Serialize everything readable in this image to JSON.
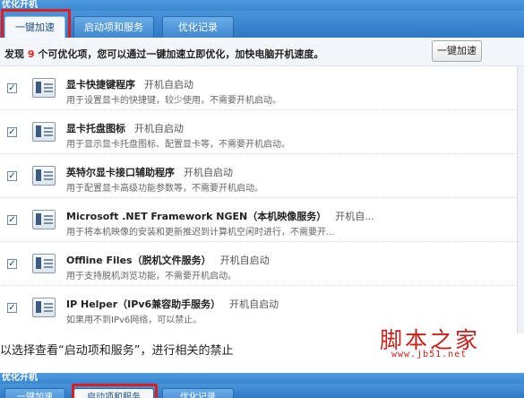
{
  "window": {
    "title": "优化开机",
    "tabs": [
      {
        "label": "一键加速",
        "active": true
      },
      {
        "label": "启动项和服务",
        "active": false
      },
      {
        "label": "优化记录",
        "active": false
      }
    ]
  },
  "info": {
    "prefix": "发现 ",
    "count": "9",
    "suffix": " 个可优化项，您可以通过一键加速立即优化，加快电脑开机速度。",
    "button": "一键加速"
  },
  "items": [
    {
      "checked": true,
      "name": "显卡快捷键程序",
      "status": "开机自启动",
      "desc": "用于设置显卡的快捷键，较少使用，不需要开机启动。"
    },
    {
      "checked": true,
      "name": "显卡托盘图标",
      "status": "开机自启动",
      "desc": "用于显示显卡托盘图标、配置显卡等，不需要开机启动。"
    },
    {
      "checked": true,
      "name": "英特尔显卡接口辅助程序",
      "status": "开机自启动",
      "desc": "用于配置显卡高级功能参数等，不需要开机启动。"
    },
    {
      "checked": true,
      "name": "Microsoft .NET Framework NGEN（本机映像服务）",
      "status": "开机自...",
      "desc": "用于将本机映像的安装和更新推迟到计算机空闲时进行，不需要开..."
    },
    {
      "checked": true,
      "name": "Offline Files（脱机文件服务）",
      "status": "开机自启动",
      "desc": "用于支持脱机浏览功能，不需要开机启动。"
    },
    {
      "checked": true,
      "name": "IP Helper（IPv6兼容助手服务）",
      "status": "开机自启动",
      "desc": "如果用不到IPv6网络，可以禁止。"
    }
  ],
  "caption": "以选择查看“启动项和服务”，进行相关的禁止",
  "watermark": {
    "main": "脚本之家",
    "url": "www.jb51.net"
  },
  "window2": {
    "title": "优化开机",
    "tabs": [
      {
        "label": "一键加速"
      },
      {
        "label": "启动项和服务"
      },
      {
        "label": "优化记录"
      }
    ]
  },
  "colors": {
    "titlebar": "#3a86d0",
    "highlight": "#e01c1c",
    "count": "#e0261d",
    "watermark": "#c8201a"
  }
}
